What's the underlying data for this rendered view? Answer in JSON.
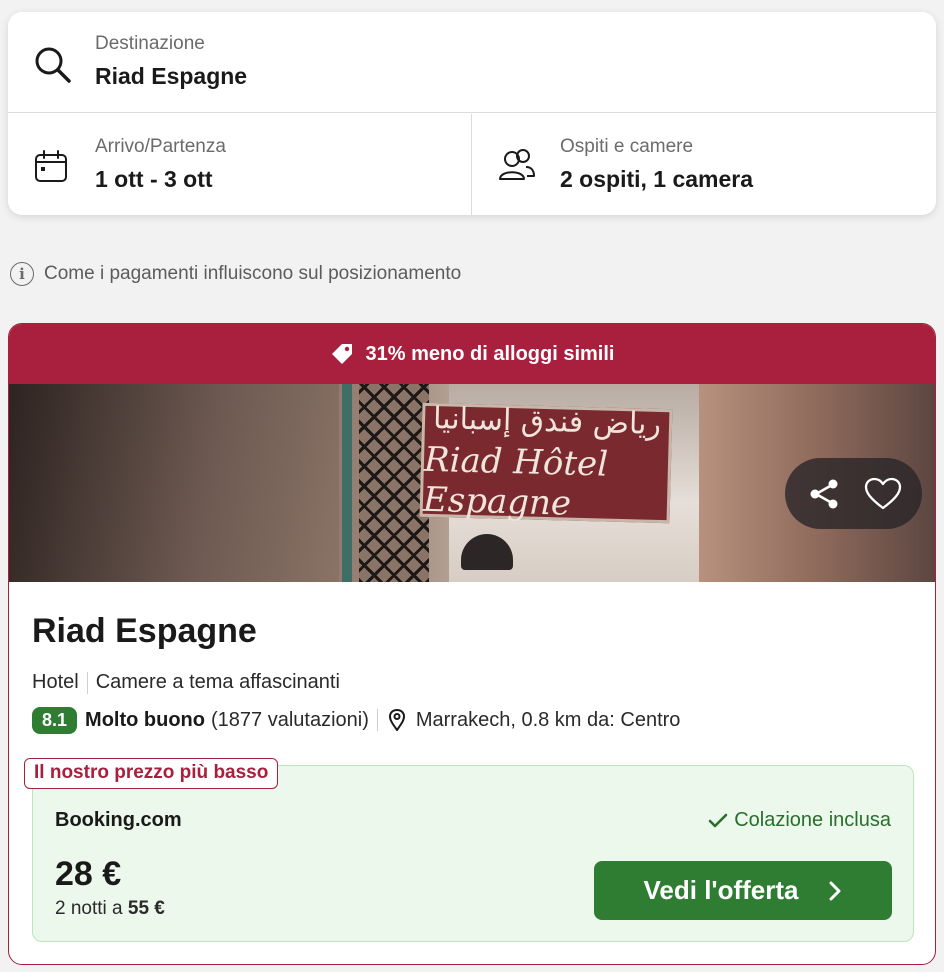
{
  "search": {
    "destination_label": "Destinazione",
    "destination_value": "Riad Espagne",
    "dates_label": "Arrivo/Partenza",
    "dates_value": "1 ott - 3 ott",
    "guests_label": "Ospiti e camere",
    "guests_value": "2 ospiti, 1 camera"
  },
  "info_note": "Come i pagamenti influiscono sul posizionamento",
  "hotel": {
    "deal_banner": "31% meno di alloggi simili",
    "photo_sign_arabic": "رياض فندق إسبانيا",
    "photo_sign_latin": "Riad Hôtel Espagne",
    "name": "Riad Espagne",
    "type": "Hotel",
    "tagline": "Camere a tema affascinanti",
    "score": "8.1",
    "rating_label": "Molto buono",
    "reviews": "(1877 valutazioni)",
    "location": "Marrakech, 0.8 km da: Centro"
  },
  "offer": {
    "badge": "Il nostro prezzo più basso",
    "provider": "Booking.com",
    "breakfast": "Colazione inclusa",
    "price": "28 €",
    "nights_prefix": "2 notti a",
    "nights_total": "55 €",
    "button_label": "Vedi l'offerta"
  },
  "colors": {
    "brand_red": "#a8203d",
    "green": "#2e7d32",
    "offer_bg": "#ecf8ec"
  },
  "icons": [
    "search-icon",
    "calendar-icon",
    "guests-icon",
    "info-icon",
    "tag-icon",
    "share-icon",
    "heart-icon",
    "location-pin-icon",
    "check-icon",
    "chevron-right-icon"
  ]
}
